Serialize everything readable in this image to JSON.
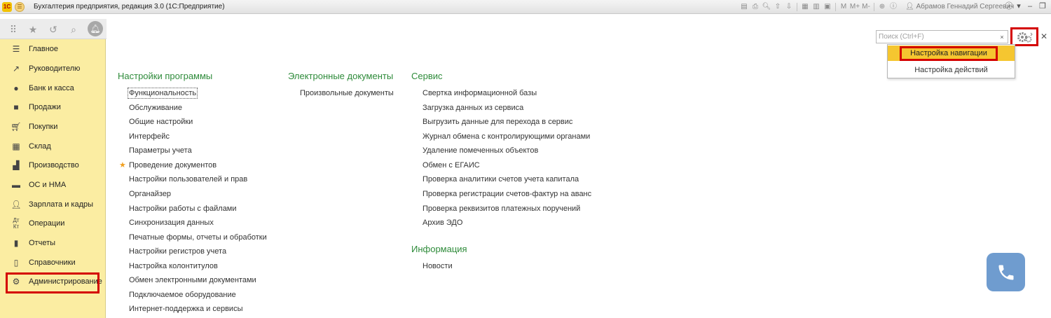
{
  "window": {
    "title": "Бухгалтерия предприятия, редакция 3.0  (1С:Предприятие)",
    "user": "Абрамов Геннадий Сергеевич",
    "toolbar_icons": [
      "save-icon",
      "print-icon",
      "preview-icon",
      "upload-icon",
      "download-icon",
      "calendar-icon",
      "table-icon",
      "calculator-icon",
      "m-button",
      "m-plus-button",
      "m-minus-button",
      "zoom-icon",
      "info-icon",
      "user-icon"
    ],
    "m_label": "M",
    "m_plus_label": "M+",
    "m_minus_label": "M-",
    "logo_label": "1C"
  },
  "sidebar": {
    "items": [
      {
        "label": "Главное",
        "icon": "menu-icon"
      },
      {
        "label": "Руководителю",
        "icon": "trend-icon"
      },
      {
        "label": "Банк и касса",
        "icon": "ruble-icon"
      },
      {
        "label": "Продажи",
        "icon": "bag-icon"
      },
      {
        "label": "Покупки",
        "icon": "cart-icon"
      },
      {
        "label": "Склад",
        "icon": "warehouse-icon"
      },
      {
        "label": "Производство",
        "icon": "factory-icon"
      },
      {
        "label": "ОС и НМА",
        "icon": "car-icon"
      },
      {
        "label": "Зарплата и кадры",
        "icon": "person-icon"
      },
      {
        "label": "Операции",
        "icon": "dt-kt-icon"
      },
      {
        "label": "Отчеты",
        "icon": "bar-chart-icon"
      },
      {
        "label": "Справочники",
        "icon": "book-icon"
      },
      {
        "label": "Администрирование",
        "icon": "gear-icon"
      }
    ]
  },
  "main": {
    "sections": [
      {
        "title": "Настройки программы",
        "links": [
          "Функциональность",
          "Обслуживание",
          "Общие настройки",
          "Интерфейс",
          "Параметры учета",
          "Проведение документов",
          "Настройки пользователей и прав",
          "Органайзер",
          "Настройки работы с файлами",
          "Синхронизация данных",
          "Печатные формы, отчеты и обработки",
          "Настройки регистров учета",
          "Настройка колонтитулов",
          "Обмен электронными документами",
          "Подключаемое оборудование",
          "Интернет-поддержка и сервисы"
        ]
      },
      {
        "title": "Электронные документы",
        "links": [
          "Произвольные документы"
        ]
      },
      {
        "title": "Сервис",
        "links": [
          "Свертка информационной базы",
          "Загрузка данных из сервиса",
          "Выгрузить данные для перехода в сервис",
          "Журнал обмена с контролирующими органами",
          "Удаление помеченных объектов",
          "Обмен с ЕГАИС",
          "Проверка аналитики счетов учета капитала",
          "Проверка регистрации счетов-фактур на аванс",
          "Проверка реквизитов платежных поручений",
          "Архив ЭДО"
        ]
      },
      {
        "title": "Информация",
        "links": [
          "Новости"
        ]
      }
    ]
  },
  "search": {
    "placeholder": "Поиск (Ctrl+F)",
    "clear_label": "×"
  },
  "dropdown": {
    "items": [
      "Настройка навигации",
      "Настройка действий"
    ]
  },
  "colors": {
    "sidebar_bg": "#fbeda2",
    "section_title": "#2e8b3a",
    "highlight_red": "#d40000",
    "dropdown_selected": "#f5c630",
    "phone_widget": "#6f9ccf"
  }
}
